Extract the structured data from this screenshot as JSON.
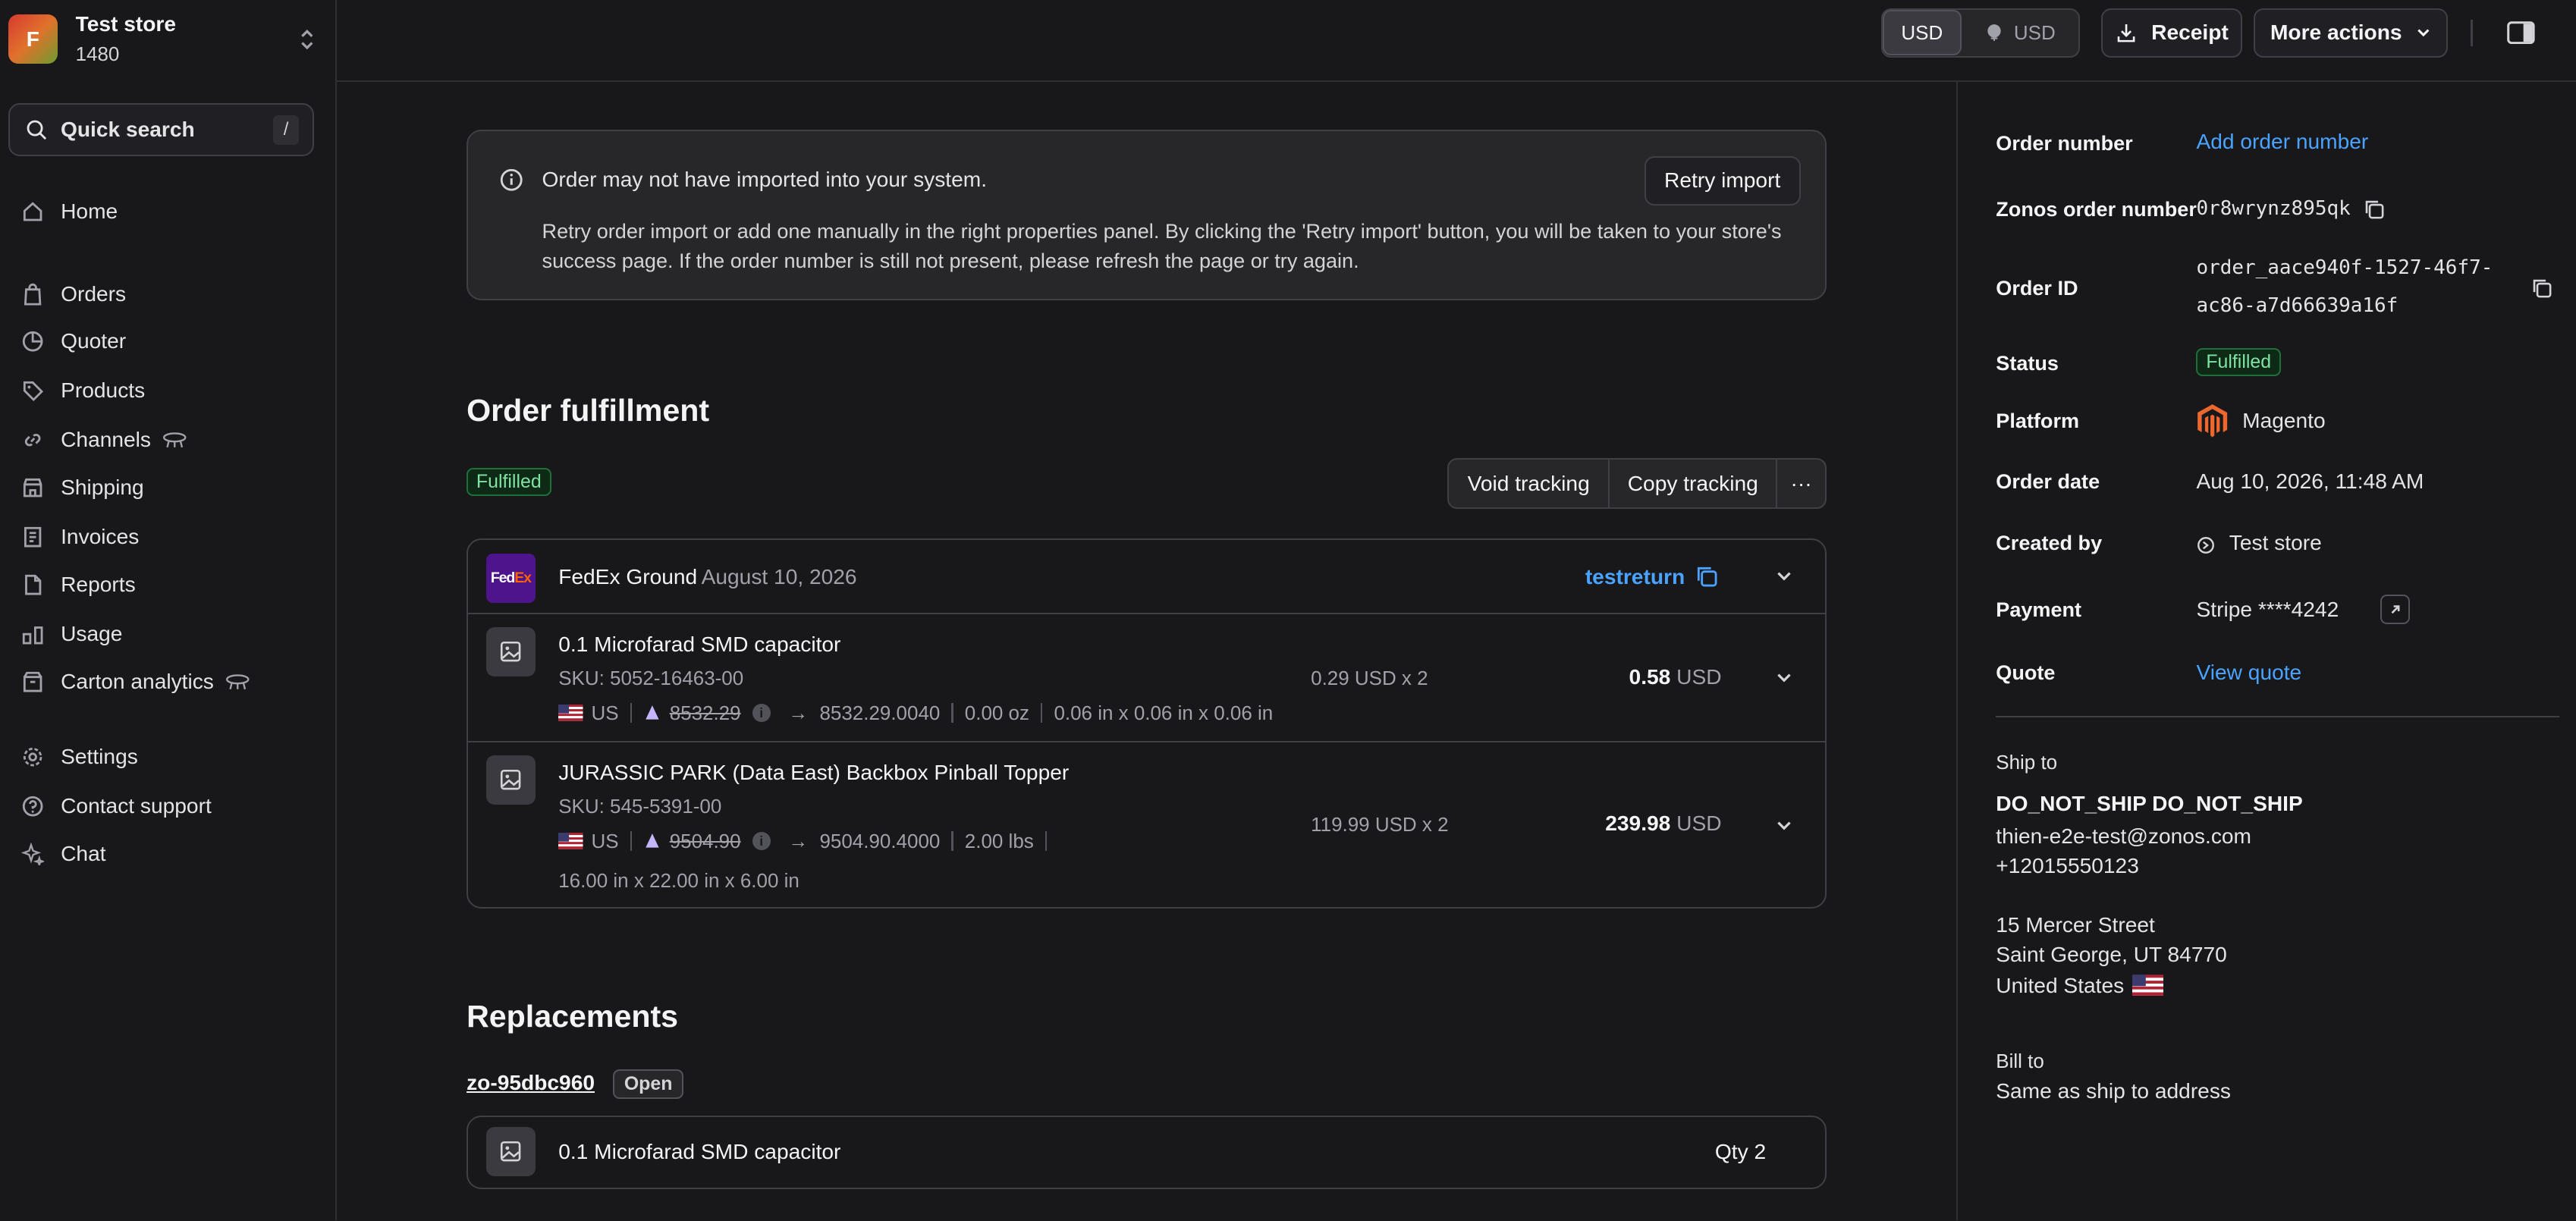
{
  "store": {
    "initial": "F",
    "name": "Test store",
    "id": "1480"
  },
  "search": {
    "label": "Quick search",
    "shortcut": "/"
  },
  "nav": [
    {
      "label": "Home",
      "icon": "home-icon"
    },
    {
      "label": "Orders",
      "icon": "bag-icon"
    },
    {
      "label": "Quoter",
      "icon": "pie-icon"
    },
    {
      "label": "Products",
      "icon": "tag-icon"
    },
    {
      "label": "Channels",
      "icon": "link-icon"
    },
    {
      "label": "Shipping",
      "icon": "store-icon"
    },
    {
      "label": "Invoices",
      "icon": "receipt-icon"
    },
    {
      "label": "Reports",
      "icon": "file-icon"
    },
    {
      "label": "Usage",
      "icon": "usage-icon"
    },
    {
      "label": "Carton analytics",
      "icon": "box-icon"
    },
    {
      "label": "Settings",
      "icon": "gear-icon"
    },
    {
      "label": "Contact support",
      "icon": "help-icon"
    },
    {
      "label": "Chat",
      "icon": "sparkle-icon"
    }
  ],
  "topbar": {
    "currency_a": "USD",
    "currency_b": "USD",
    "receipt": "Receipt",
    "more_actions": "More actions"
  },
  "alert": {
    "title": "Order may not have imported into your system.",
    "body": "Retry order import or add one manually in the right properties panel. By clicking the 'Retry import' button, you will be taken to your store's success page. If the order number is still not present, please refresh the page or try again.",
    "retry": "Retry import"
  },
  "fulfillment": {
    "title": "Order fulfillment",
    "status": "Fulfilled",
    "void": "Void tracking",
    "copy": "Copy tracking",
    "more": "···",
    "carrier": "FedEx Ground",
    "date": "August 10, 2026",
    "tracking": "testreturn",
    "items": [
      {
        "name": "0.1 Microfarad SMD capacitor",
        "sku": "SKU: 5052-16463-00",
        "country": "US",
        "hs_old": "8532.29",
        "hs_new": "8532.29.0040",
        "weight": "0.00 oz",
        "dims": "0.06 in x 0.06 in x 0.06 in",
        "unit": "0.29 USD x 2",
        "total": "0.58",
        "currency": "USD"
      },
      {
        "name": "JURASSIC PARK (Data East) Backbox Pinball Topper",
        "sku": "SKU: 545-5391-00",
        "country": "US",
        "hs_old": "9504.90",
        "hs_new": "9504.90.4000",
        "weight": "2.00 lbs",
        "dims": "16.00 in x 22.00 in x 6.00 in",
        "unit": "119.99 USD x 2",
        "total": "239.98",
        "currency": "USD"
      }
    ]
  },
  "replacements": {
    "title": "Replacements",
    "order": "zo-95dbc960",
    "status": "Open",
    "item": "0.1 Microfarad SMD capacitor",
    "qty": "Qty 2"
  },
  "panel": {
    "order_number_label": "Order number",
    "order_number_value": "Add order number",
    "zonos_label": "Zonos order number",
    "zonos_value": "0r8wrynz895qk",
    "order_id_label": "Order ID",
    "order_id_line1": "order_aace940f-1527-46f7-",
    "order_id_line2": "ac86-a7d66639a16f",
    "status_label": "Status",
    "status_value": "Fulfilled",
    "platform_label": "Platform",
    "platform_value": "Magento",
    "date_label": "Order date",
    "date_value": "Aug 10, 2026, 11:48 AM",
    "created_label": "Created by",
    "created_value": "Test store",
    "payment_label": "Payment",
    "payment_value": "Stripe ****4242",
    "quote_label": "Quote",
    "quote_value": "View quote",
    "ship_to_label": "Ship to",
    "ship_name": "DO_NOT_SHIP DO_NOT_SHIP",
    "ship_email": "thien-e2e-test@zonos.com",
    "ship_phone": "+12015550123",
    "ship_street": "15 Mercer Street",
    "ship_city": "Saint George, UT 84770",
    "ship_country": "United States",
    "bill_to_label": "Bill to",
    "bill_to_value": "Same as ship to address"
  }
}
